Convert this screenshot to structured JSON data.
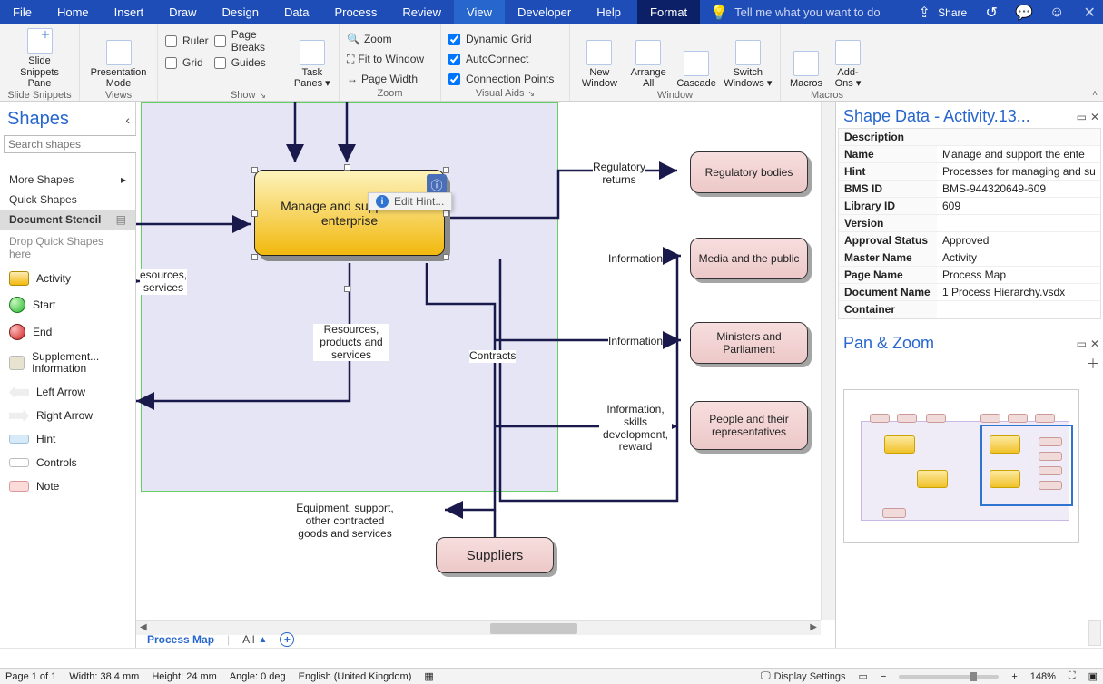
{
  "menu": {
    "items": [
      "File",
      "Home",
      "Insert",
      "Draw",
      "Design",
      "Data",
      "Process",
      "Review",
      "View",
      "Developer",
      "Help"
    ],
    "active": "View",
    "format": "Format",
    "tell_me_placeholder": "Tell me what you want to do",
    "share": "Share"
  },
  "ribbon": {
    "slide_snippets_btn": "Slide\nSnippets Pane",
    "slide_snippets_group": "Slide Snippets",
    "presentation_mode": "Presentation\nMode",
    "views_group": "Views",
    "ruler": "Ruler",
    "page_breaks": "Page Breaks",
    "grid": "Grid",
    "guides": "Guides",
    "task_panes": "Task\nPanes",
    "show_group": "Show",
    "zoom": "Zoom",
    "fit_to_window": "Fit to Window",
    "page_width": "Page Width",
    "zoom_group": "Zoom",
    "dynamic_grid": "Dynamic Grid",
    "autoconnect": "AutoConnect",
    "connection_points": "Connection Points",
    "visual_aids_group": "Visual Aids",
    "new_window": "New\nWindow",
    "arrange_all": "Arrange\nAll",
    "cascade": "Cascade",
    "switch_windows": "Switch\nWindows",
    "window_group": "Window",
    "macros": "Macros",
    "addons": "Add-\nOns",
    "macros_group": "Macros"
  },
  "shapes": {
    "title": "Shapes",
    "search_placeholder": "Search shapes",
    "more_shapes": "More Shapes",
    "quick_shapes": "Quick Shapes",
    "document_stencil": "Document Stencil",
    "drop_hint": "Drop Quick Shapes here",
    "items": [
      {
        "label": "Activity"
      },
      {
        "label": "Start"
      },
      {
        "label": "End"
      },
      {
        "label": "Supplement... Information"
      },
      {
        "label": "Left Arrow"
      },
      {
        "label": "Right Arrow"
      },
      {
        "label": "Hint"
      },
      {
        "label": "Controls"
      },
      {
        "label": "Note"
      }
    ]
  },
  "canvas": {
    "process_label": "Manage and support the enterprise",
    "edit_hint": "Edit Hint...",
    "edge_labels": {
      "resources_services": "esources,\nservices",
      "resources_products": "Resources,\nproducts and\nservices",
      "contracts": "Contracts",
      "equipment": "Equipment, support,\nother contracted\ngoods and services",
      "regulatory_returns": "Regulatory\nreturns",
      "information1": "Information",
      "information2": "Information",
      "info_skills": "Information,\nskills\ndevelopment,\nreward"
    },
    "nodes": {
      "regulatory": "Regulatory bodies",
      "media": "Media and the public",
      "ministers": "Ministers and Parliament",
      "people": "People and their representatives",
      "suppliers": "Suppliers"
    },
    "sheet_tab": "Process Map",
    "all_label": "All"
  },
  "shape_data": {
    "title": "Shape Data - Activity.13...",
    "description": "Description",
    "rows": [
      {
        "k": "Name",
        "v": "Manage and support the ente"
      },
      {
        "k": "Hint",
        "v": "Processes for managing and su"
      },
      {
        "k": "BMS ID",
        "v": "BMS-944320649-609"
      },
      {
        "k": "Library ID",
        "v": "609"
      },
      {
        "k": "Version",
        "v": ""
      },
      {
        "k": "Approval Status",
        "v": "Approved"
      },
      {
        "k": "Master Name",
        "v": "Activity"
      },
      {
        "k": "Page Name",
        "v": "Process Map"
      },
      {
        "k": "Document Name",
        "v": "1        Process Hierarchy.vsdx"
      },
      {
        "k": "Container",
        "v": ""
      }
    ]
  },
  "panzoom": {
    "title": "Pan & Zoom"
  },
  "status": {
    "page": "Page 1 of 1",
    "width": "Width: 38.4 mm",
    "height": "Height: 24 mm",
    "angle": "Angle: 0 deg",
    "lang": "English (United Kingdom)",
    "display_settings": "Display Settings",
    "zoom": "148%"
  }
}
